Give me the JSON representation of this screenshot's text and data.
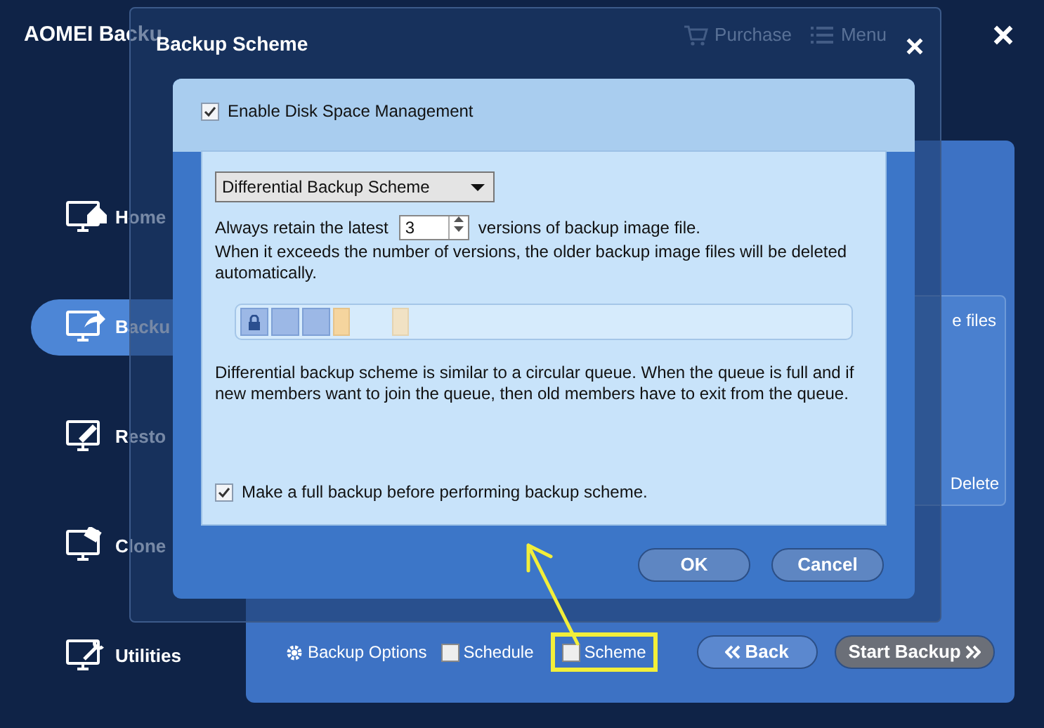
{
  "app": {
    "title": "AOMEI Backu",
    "header_links": [
      {
        "kind": "cart",
        "label": "Purchase"
      },
      {
        "kind": "menu",
        "label": "Menu"
      }
    ]
  },
  "sidebar": {
    "items": [
      {
        "kind": "home",
        "label": "Home",
        "selected": false
      },
      {
        "kind": "backup",
        "label": "Backu",
        "selected": true
      },
      {
        "kind": "restore",
        "label": "Resto",
        "selected": false
      },
      {
        "kind": "clone",
        "label": "Clone",
        "selected": false
      },
      {
        "kind": "utilities",
        "label": "Utilities",
        "selected": false
      }
    ]
  },
  "main": {
    "column_heading": "e files",
    "delete_button": "Delete",
    "bottom_bar": {
      "options_link": "Backup Options",
      "checkboxes": [
        {
          "label": "Schedule",
          "checked": false,
          "highlighted": false
        },
        {
          "label": "Scheme",
          "checked": false,
          "highlighted": true
        }
      ],
      "back_button": "Back",
      "start_button": "Start Backup"
    }
  },
  "dialog": {
    "title": "Backup Scheme",
    "enable_checkbox": {
      "label": "Enable Disk Space Management",
      "checked": true
    },
    "scheme_select": {
      "value": "Differential Backup Scheme"
    },
    "retain_prefix": "Always retain the latest",
    "retain_value": "3",
    "retain_suffix": "versions of backup image file.",
    "retain_note": "When it exceeds the number of versions, the older backup image files will be deleted automatically.",
    "queue_slots": [
      {
        "kind": "locked"
      },
      {
        "kind": "full"
      },
      {
        "kind": "full"
      },
      {
        "kind": "differential"
      },
      {
        "kind": "empty"
      },
      {
        "kind": "pending"
      }
    ],
    "description": "Differential backup scheme is similar to a circular queue. When the queue is full and if new members want to join the queue, then old members have to exit from the queue.",
    "full_backup_checkbox": {
      "label": "Make a full backup before performing backup scheme.",
      "checked": true
    },
    "buttons": [
      "OK",
      "Cancel"
    ]
  }
}
